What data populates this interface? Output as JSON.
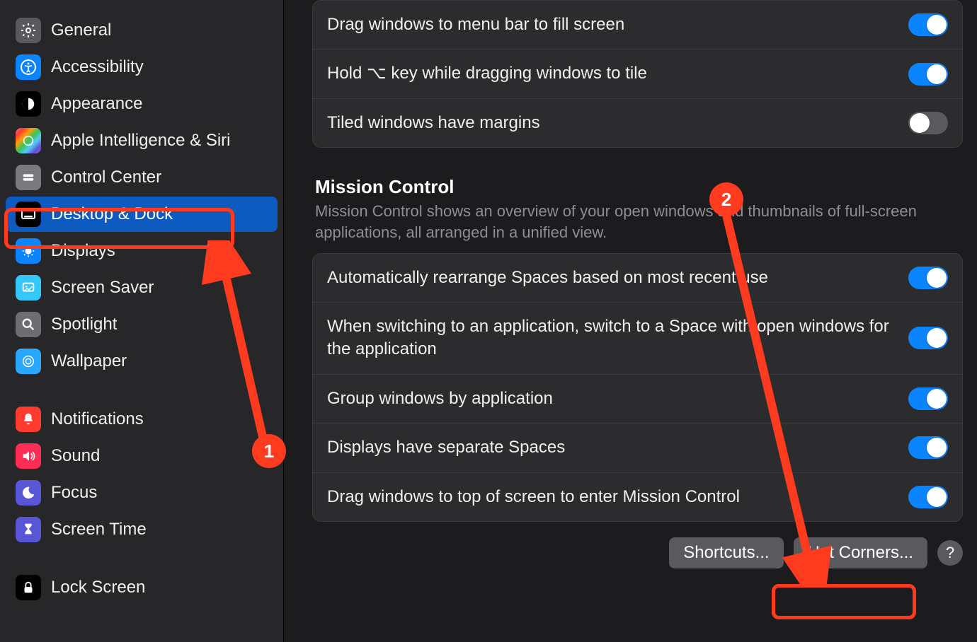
{
  "sidebar": {
    "items": [
      {
        "label": "General"
      },
      {
        "label": "Accessibility"
      },
      {
        "label": "Appearance"
      },
      {
        "label": "Apple Intelligence & Siri"
      },
      {
        "label": "Control Center"
      },
      {
        "label": "Desktop & Dock"
      },
      {
        "label": "Displays"
      },
      {
        "label": "Screen Saver"
      },
      {
        "label": "Spotlight"
      },
      {
        "label": "Wallpaper"
      },
      {
        "label": "Notifications"
      },
      {
        "label": "Sound"
      },
      {
        "label": "Focus"
      },
      {
        "label": "Screen Time"
      },
      {
        "label": "Lock Screen"
      }
    ]
  },
  "top_group": [
    {
      "label": "Drag windows to menu bar to fill screen",
      "on": true
    },
    {
      "label": "Hold ⌥ key while dragging windows to tile",
      "on": true
    },
    {
      "label": "Tiled windows have margins",
      "on": false
    }
  ],
  "mission": {
    "title": "Mission Control",
    "desc": "Mission Control shows an overview of your open windows and thumbnails of full-screen applications, all arranged in a unified view."
  },
  "mc_group": [
    {
      "label": "Automatically rearrange Spaces based on most recent use",
      "on": true
    },
    {
      "label": "When switching to an application, switch to a Space with open windows for the application",
      "on": true
    },
    {
      "label": "Group windows by application",
      "on": true
    },
    {
      "label": "Displays have separate Spaces",
      "on": true
    },
    {
      "label": "Drag windows to top of screen to enter Mission Control",
      "on": true
    }
  ],
  "buttons": {
    "shortcuts": "Shortcuts...",
    "hotcorners": "Hot Corners...",
    "help": "?"
  },
  "annotations": {
    "n1": "1",
    "n2": "2"
  }
}
